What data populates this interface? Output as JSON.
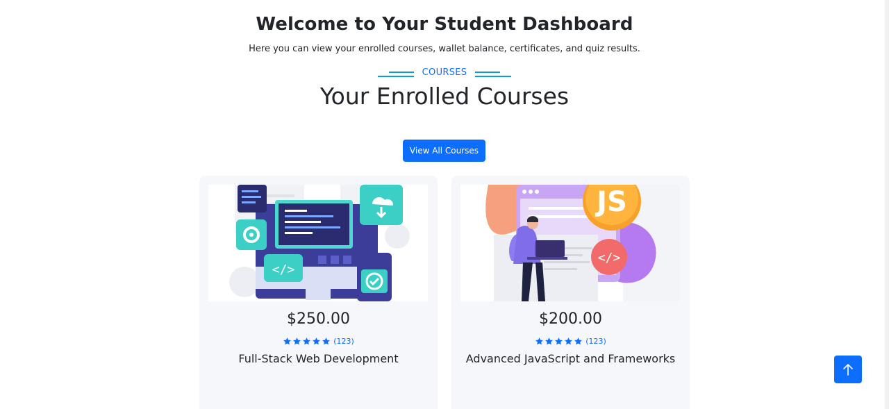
{
  "header": {
    "title": "Welcome to Your Student Dashboard",
    "subtitle": "Here you can view your enrolled courses, wallet balance, certificates, and quiz results."
  },
  "section": {
    "eyebrow": "COURSES",
    "title": "Your Enrolled Courses",
    "view_all_label": "View All Courses"
  },
  "courses": [
    {
      "price": "$250.00",
      "rating_stars": 5,
      "rating_count": "(123)",
      "title": "Full-Stack Web Development",
      "image_icon": "web-development-illustration"
    },
    {
      "price": "$200.00",
      "rating_stars": 5,
      "rating_count": "(123)",
      "title": "Advanced JavaScript and Frameworks",
      "image_icon": "javascript-illustration",
      "image_text": "JS"
    }
  ],
  "scroll_top": {
    "icon": "arrow-up-icon"
  },
  "colors": {
    "primary": "#0d6efd",
    "accent_line": "#0d9bdb",
    "card_bg": "#f6f7fb",
    "text": "#212529"
  }
}
